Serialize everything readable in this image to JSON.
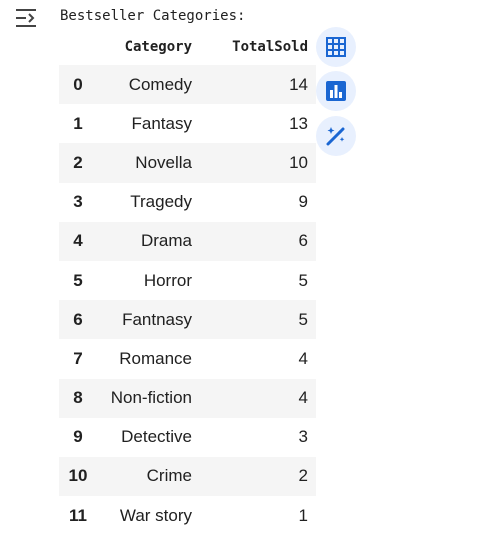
{
  "output": {
    "title": "Bestseller Categories:"
  },
  "table": {
    "columns": [
      "",
      "Category",
      "TotalSold"
    ],
    "rows": [
      {
        "index": "0",
        "category": "Comedy",
        "total": "14"
      },
      {
        "index": "1",
        "category": "Fantasy",
        "total": "13"
      },
      {
        "index": "2",
        "category": "Novella",
        "total": "10"
      },
      {
        "index": "3",
        "category": "Tragedy",
        "total": "9"
      },
      {
        "index": "4",
        "category": "Drama",
        "total": "6"
      },
      {
        "index": "5",
        "category": "Horror",
        "total": "5"
      },
      {
        "index": "6",
        "category": "Fantnasy",
        "total": "5"
      },
      {
        "index": "7",
        "category": "Romance",
        "total": "4"
      },
      {
        "index": "8",
        "category": "Non-fiction",
        "total": "4"
      },
      {
        "index": "9",
        "category": "Detective",
        "total": "3"
      },
      {
        "index": "10",
        "category": "Crime",
        "total": "2"
      },
      {
        "index": "11",
        "category": "War story",
        "total": "1"
      }
    ]
  },
  "actions": [
    {
      "icon": "table-icon"
    },
    {
      "icon": "bar-chart-icon"
    },
    {
      "icon": "magic-pen-icon"
    }
  ],
  "colors": {
    "accent": "#1a66d2",
    "button_bg": "#e8f0fe",
    "stripe": "#f5f5f5"
  }
}
